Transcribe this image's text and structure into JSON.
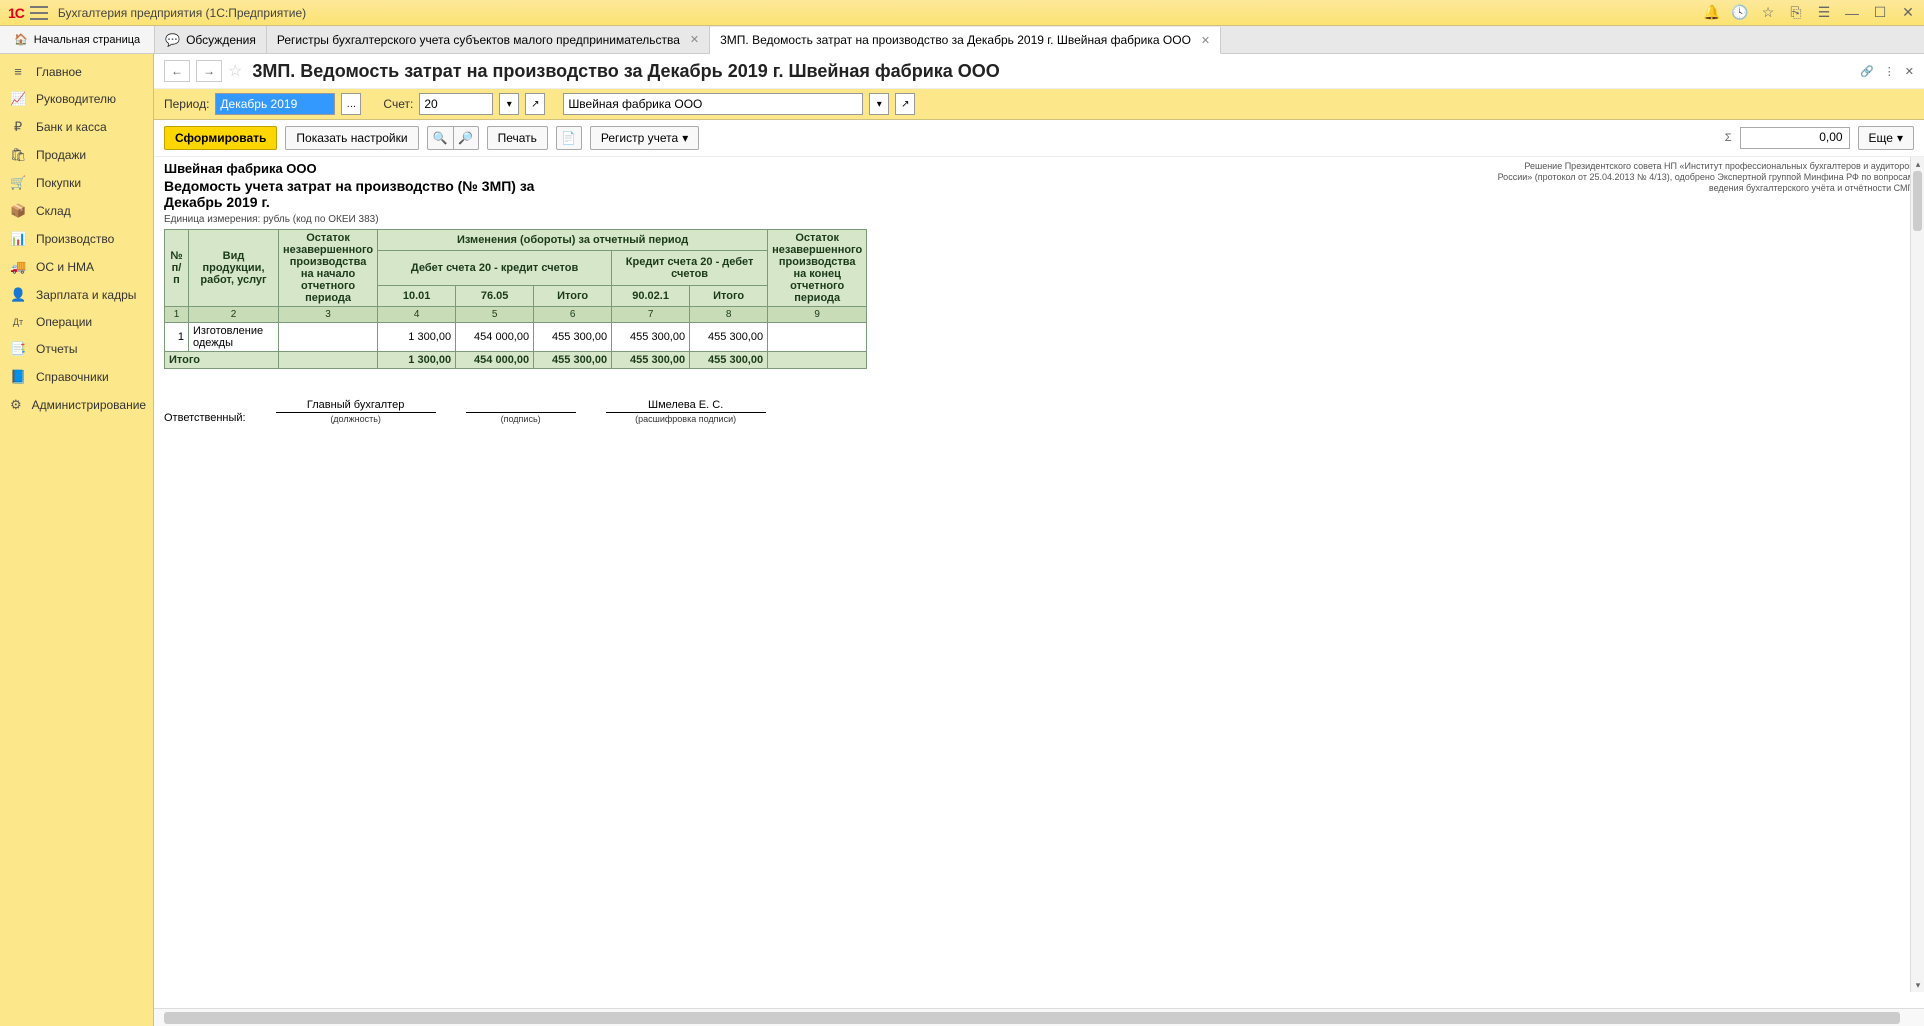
{
  "titlebar": {
    "app_title": "Бухгалтерия предприятия  (1С:Предприятие)"
  },
  "tabs": {
    "home": "Начальная страница",
    "discussions": "Обсуждения",
    "t1": "Регистры бухгалтерского учета субъектов малого предпринимательства",
    "t2": "3МП. Ведомость затрат на производство за Декабрь 2019 г. Швейная фабрика ООО"
  },
  "sidebar": {
    "items": [
      {
        "icon": "≡",
        "label": "Главное"
      },
      {
        "icon": "📈",
        "label": "Руководителю"
      },
      {
        "icon": "₽",
        "label": "Банк и касса"
      },
      {
        "icon": "🛍",
        "label": "Продажи"
      },
      {
        "icon": "🛒",
        "label": "Покупки"
      },
      {
        "icon": "📦",
        "label": "Склад"
      },
      {
        "icon": "📊",
        "label": "Производство"
      },
      {
        "icon": "🚚",
        "label": "ОС и НМА"
      },
      {
        "icon": "👤",
        "label": "Зарплата и кадры"
      },
      {
        "icon": "Дт",
        "label": "Операции"
      },
      {
        "icon": "📑",
        "label": "Отчеты"
      },
      {
        "icon": "📘",
        "label": "Справочники"
      },
      {
        "icon": "⚙",
        "label": "Администрирование"
      }
    ]
  },
  "page": {
    "title": "3МП. Ведомость затрат на производство за Декабрь 2019 г. Швейная фабрика ООО"
  },
  "params": {
    "period_lbl": "Период:",
    "period_val": "Декабрь 2019",
    "account_lbl": "Счет:",
    "account_val": "20",
    "org_val": "Швейная фабрика ООО"
  },
  "toolbar": {
    "generate": "Сформировать",
    "show_settings": "Показать настройки",
    "print": "Печать",
    "register": "Регистр учета",
    "sum": "0,00",
    "more": "Еще"
  },
  "report": {
    "org": "Швейная фабрика ООО",
    "title": "Ведомость учета затрат на производство (№ 3МП) за Декабрь 2019 г.",
    "note": "Решение Президентского совета НП «Институт профессиональных бухгалтеров и аудиторов России» (протокол от 25.04.2013 № 4/13), одобрено Экспертной группой Минфина РФ по вопросам ведения бухгалтерского учёта и отчётности СМП",
    "unit": "Единица измерения:   рубль (код по ОКЕИ 383)",
    "headers": {
      "num": "№ п/п",
      "prod": "Вид продукции, работ, услуг",
      "bal_start": "Остаток незавершенного производства на начало отчетного периода",
      "changes": "Изменения (обороты) за отчетный период",
      "debit": "Дебет счета 20 - кредит счетов",
      "credit": "Кредит счета 20 - дебет счетов",
      "c1": "10.01",
      "c2": "76.05",
      "c3": "Итого",
      "c4": "90.02.1",
      "c5": "Итого",
      "bal_end": "Остаток незавершенного производства на конец отчетного периода"
    },
    "colnums": [
      "1",
      "2",
      "3",
      "4",
      "5",
      "6",
      "7",
      "8",
      "9"
    ],
    "rows": [
      {
        "n": "1",
        "name": "Изготовление одежды",
        "v1": "1 300,00",
        "v2": "454 000,00",
        "v3": "455 300,00",
        "v4": "455 300,00",
        "v5": "455 300,00"
      }
    ],
    "total_lbl": "Итого",
    "totals": {
      "v1": "1 300,00",
      "v2": "454 000,00",
      "v3": "455 300,00",
      "v4": "455 300,00",
      "v5": "455 300,00"
    }
  },
  "sign": {
    "resp": "Ответственный:",
    "pos_val": "Главный бухгалтер",
    "pos_lbl": "(должность)",
    "sign_lbl": "(подпись)",
    "name_val": "Шмелева Е. С.",
    "name_lbl": "(расшифровка подписи)"
  }
}
